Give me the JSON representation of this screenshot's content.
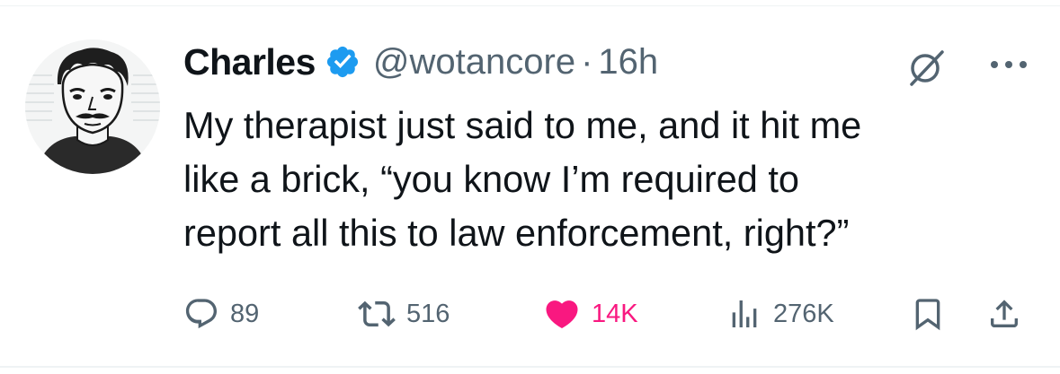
{
  "post": {
    "author_name": "Charles",
    "handle": "@wotancore",
    "separator": "·",
    "time_ago": "16h",
    "text_lines": [
      "My therapist just said to me, and it hit me",
      "like a brick, “you know I’m required to",
      "report all this to law enforcement, right?”"
    ]
  },
  "actions": {
    "replies": "89",
    "reposts": "516",
    "likes": "14K",
    "views": "276K"
  },
  "icons": {
    "verified": "verified-badge-icon",
    "grok": "grok-icon",
    "more": "more-options-icon",
    "reply": "reply-icon",
    "repost": "repost-icon",
    "like": "heart-icon",
    "views": "views-icon",
    "bookmark": "bookmark-icon",
    "share": "share-icon"
  },
  "colors": {
    "text": "#0f1419",
    "secondary": "#536471",
    "verified": "#1d9bf0",
    "like": "#f91880"
  }
}
